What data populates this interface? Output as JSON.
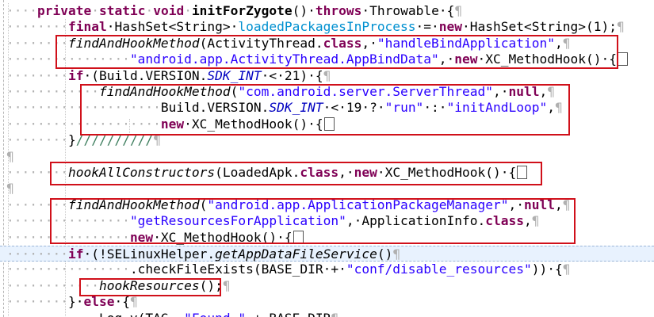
{
  "editor": {
    "lines": [
      {
        "indent": "····",
        "segments": [
          {
            "t": "private",
            "c": "kw"
          },
          {
            "t": "·",
            "c": "ws"
          },
          {
            "t": "static",
            "c": "kw"
          },
          {
            "t": "·",
            "c": "ws"
          },
          {
            "t": "void",
            "c": "kw"
          },
          {
            "t": "·",
            "c": "ws"
          },
          {
            "t": "initForZygote",
            "c": "bold"
          },
          {
            "t": "()·",
            "c": ""
          },
          {
            "t": "throws",
            "c": "kw"
          },
          {
            "t": "·Throwable·{",
            "c": ""
          },
          {
            "t": "¶",
            "c": "pil"
          }
        ]
      },
      {
        "indent": "········",
        "segments": [
          {
            "t": "final",
            "c": "kw"
          },
          {
            "t": "·HashSet<String>·",
            "c": ""
          },
          {
            "t": "loadedPackagesInProcess",
            "c": "lfld"
          },
          {
            "t": "·=·",
            "c": ""
          },
          {
            "t": "new",
            "c": "kw"
          },
          {
            "t": "·HashSet<String>(1);",
            "c": ""
          },
          {
            "t": "¶",
            "c": "pil"
          }
        ]
      },
      {
        "indent": "········",
        "segments": [
          {
            "t": "findAndHookMethod",
            "c": "smeth"
          },
          {
            "t": "(ActivityThread.",
            "c": ""
          },
          {
            "t": "class",
            "c": "kw"
          },
          {
            "t": ",·",
            "c": ""
          },
          {
            "t": "\"handleBindApplication\"",
            "c": "str"
          },
          {
            "t": ",",
            "c": ""
          },
          {
            "t": "¶",
            "c": "pil"
          }
        ]
      },
      {
        "indent": "················",
        "segments": [
          {
            "t": "\"android.app.ActivityThread.AppBindData\"",
            "c": "str"
          },
          {
            "t": ",·",
            "c": ""
          },
          {
            "t": "new",
            "c": "kw"
          },
          {
            "t": "·XC_MethodHook()·{",
            "c": ""
          },
          {
            "t": "FOLD",
            "c": "fold"
          }
        ]
      },
      {
        "indent": "········",
        "segments": [
          {
            "t": "if",
            "c": "kw"
          },
          {
            "t": "·(Build.VERSION.",
            "c": ""
          },
          {
            "t": "SDK_INT",
            "c": "fld"
          },
          {
            "t": "·<·21)·{",
            "c": ""
          },
          {
            "t": "¶",
            "c": "pil"
          }
        ]
      },
      {
        "indent": "············",
        "segments": [
          {
            "t": "findAndHookMethod",
            "c": "smeth"
          },
          {
            "t": "(",
            "c": ""
          },
          {
            "t": "\"com.android.server.ServerThread\"",
            "c": "str"
          },
          {
            "t": ",·",
            "c": ""
          },
          {
            "t": "null",
            "c": "kw"
          },
          {
            "t": ",",
            "c": ""
          },
          {
            "t": "¶",
            "c": "pil"
          }
        ]
      },
      {
        "indent": "····················",
        "segments": [
          {
            "t": "Build.VERSION.",
            "c": ""
          },
          {
            "t": "SDK_INT",
            "c": "fld"
          },
          {
            "t": "·<·19·?·",
            "c": ""
          },
          {
            "t": "\"run\"",
            "c": "str"
          },
          {
            "t": "·:·",
            "c": ""
          },
          {
            "t": "\"initAndLoop\"",
            "c": "str"
          },
          {
            "t": ",",
            "c": ""
          },
          {
            "t": "¶",
            "c": "pil"
          }
        ]
      },
      {
        "indent": "····················",
        "segments": [
          {
            "t": "new",
            "c": "kw"
          },
          {
            "t": "·XC_MethodHook()·{",
            "c": ""
          },
          {
            "t": "FOLD",
            "c": "fold"
          }
        ]
      },
      {
        "indent": "········",
        "segments": [
          {
            "t": "}",
            "c": ""
          },
          {
            "t": "//////////",
            "c": "cmt"
          },
          {
            "t": "¶",
            "c": "pil"
          }
        ]
      },
      {
        "indent": "",
        "segments": [
          {
            "t": "¶",
            "c": "pil"
          }
        ]
      },
      {
        "indent": "········",
        "segments": [
          {
            "t": "hookAllConstructors",
            "c": "smeth"
          },
          {
            "t": "(LoadedApk.",
            "c": ""
          },
          {
            "t": "class",
            "c": "kw"
          },
          {
            "t": ",·",
            "c": ""
          },
          {
            "t": "new",
            "c": "kw"
          },
          {
            "t": "·XC_MethodHook()·{",
            "c": ""
          },
          {
            "t": "FOLD",
            "c": "fold"
          }
        ]
      },
      {
        "indent": "",
        "segments": [
          {
            "t": "¶",
            "c": "pil"
          }
        ]
      },
      {
        "indent": "········",
        "segments": [
          {
            "t": "findAndHookMethod",
            "c": "smeth"
          },
          {
            "t": "(",
            "c": ""
          },
          {
            "t": "\"android.app.ApplicationPackageManager\"",
            "c": "str"
          },
          {
            "t": ",·",
            "c": ""
          },
          {
            "t": "null",
            "c": "kw"
          },
          {
            "t": ",",
            "c": ""
          },
          {
            "t": "¶",
            "c": "pil"
          }
        ]
      },
      {
        "indent": "················",
        "segments": [
          {
            "t": "\"getResourcesForApplication\"",
            "c": "str"
          },
          {
            "t": ",·ApplicationInfo.",
            "c": ""
          },
          {
            "t": "class",
            "c": "kw"
          },
          {
            "t": ",",
            "c": ""
          },
          {
            "t": "¶",
            "c": "pil"
          }
        ]
      },
      {
        "indent": "················",
        "segments": [
          {
            "t": "new",
            "c": "kw"
          },
          {
            "t": "·XC_MethodHook()·{",
            "c": ""
          },
          {
            "t": "FOLD",
            "c": "fold"
          }
        ]
      },
      {
        "indent": "········",
        "current": true,
        "segments": [
          {
            "t": "if",
            "c": "kw"
          },
          {
            "t": "·(!SELinuxHelper.",
            "c": ""
          },
          {
            "t": "getAppDataFileService",
            "c": "smeth"
          },
          {
            "t": "()",
            "c": ""
          },
          {
            "t": "¶",
            "c": "pil"
          }
        ]
      },
      {
        "indent": "················",
        "segments": [
          {
            "t": ".checkFileExists(BASE_DIR·+·",
            "c": ""
          },
          {
            "t": "\"conf/disable_resources\"",
            "c": "str"
          },
          {
            "t": "))·{",
            "c": ""
          },
          {
            "t": "¶",
            "c": "pil"
          }
        ]
      },
      {
        "indent": "············",
        "segments": [
          {
            "t": "hookResources",
            "c": "smeth"
          },
          {
            "t": "();",
            "c": ""
          },
          {
            "t": "¶",
            "c": "pil"
          }
        ]
      },
      {
        "indent": "········",
        "segments": [
          {
            "t": "}·",
            "c": ""
          },
          {
            "t": "else",
            "c": "kw"
          },
          {
            "t": "·{",
            "c": ""
          },
          {
            "t": "¶",
            "c": "pil"
          }
        ]
      },
      {
        "indent": "············",
        "segments": [
          {
            "t": "Log.v(TAG,·",
            "c": ""
          },
          {
            "t": "\"Found·\"",
            "c": "str"
          },
          {
            "t": "·+·BASE_DIR",
            "c": ""
          },
          {
            "t": "¶",
            "c": "pil"
          }
        ]
      }
    ]
  }
}
